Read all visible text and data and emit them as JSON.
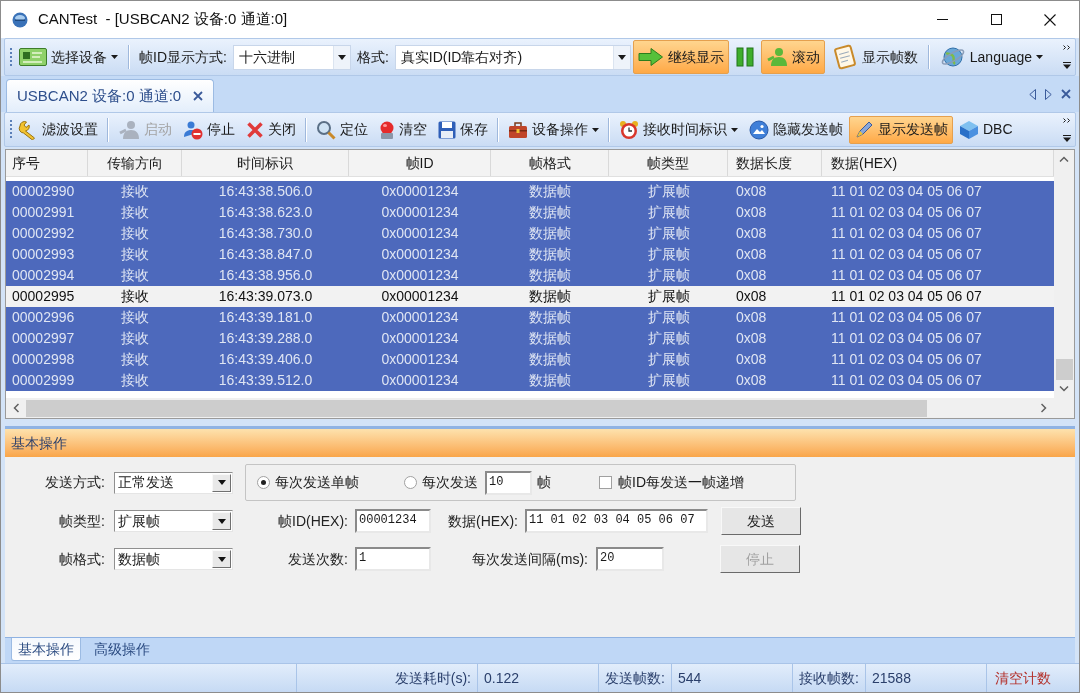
{
  "window": {
    "title": "CANTest  - [USBCAN2 设备:0 通道:0]"
  },
  "toolbar": {
    "items": [
      {
        "kind": "button",
        "label": "选择设备",
        "dropdown": true,
        "highlighted": false
      },
      {
        "kind": "separator"
      },
      {
        "kind": "label",
        "label": "帧ID显示方式:"
      },
      {
        "kind": "combo",
        "value": "十六进制"
      },
      {
        "kind": "label",
        "label": "格式:"
      },
      {
        "kind": "combo",
        "value": "真实ID(ID靠右对齐)"
      },
      {
        "kind": "button",
        "label": "继续显示",
        "dropdown": false,
        "highlighted": true
      },
      {
        "kind": "button",
        "dropdown": false,
        "highlighted": false
      },
      {
        "kind": "button",
        "label": "滚动",
        "dropdown": false,
        "highlighted": true
      },
      {
        "kind": "button",
        "label": "显示帧数",
        "dropdown": false,
        "highlighted": false
      },
      {
        "kind": "separator"
      },
      {
        "kind": "button",
        "label": "Language",
        "dropdown": true,
        "highlighted": false
      }
    ]
  },
  "document_tabs": [
    {
      "label": "USBCAN2 设备:0 通道:0",
      "selected": true
    }
  ],
  "toolbar_2": {
    "items": [
      {
        "kind": "button",
        "label": "滤波设置",
        "dropdown": false,
        "highlighted": false,
        "disabled": false
      },
      {
        "kind": "separator"
      },
      {
        "kind": "button",
        "label": "启动",
        "dropdown": false,
        "highlighted": false,
        "disabled": true
      },
      {
        "kind": "button",
        "label": "停止",
        "dropdown": false,
        "highlighted": false,
        "disabled": false
      },
      {
        "kind": "button",
        "label": "关闭",
        "dropdown": false,
        "highlighted": false,
        "disabled": false
      },
      {
        "kind": "separator"
      },
      {
        "kind": "button",
        "label": "定位",
        "dropdown": false,
        "highlighted": false,
        "disabled": false
      },
      {
        "kind": "button",
        "label": "清空",
        "dropdown": false,
        "highlighted": false,
        "disabled": false
      },
      {
        "kind": "button",
        "label": "保存",
        "dropdown": false,
        "highlighted": false,
        "disabled": false
      },
      {
        "kind": "separator"
      },
      {
        "kind": "button",
        "label": "设备操作",
        "dropdown": true,
        "highlighted": false,
        "disabled": false
      },
      {
        "kind": "separator"
      },
      {
        "kind": "button",
        "label": "接收时间标识",
        "dropdown": true,
        "highlighted": false,
        "disabled": false
      },
      {
        "kind": "button",
        "label": "隐藏发送帧",
        "dropdown": false,
        "highlighted": false,
        "disabled": false
      },
      {
        "kind": "button",
        "label": "显示发送帧",
        "dropdown": false,
        "highlighted": true,
        "disabled": false
      },
      {
        "kind": "button",
        "label": "DBC",
        "dropdown": false,
        "highlighted": false,
        "disabled": false
      }
    ]
  },
  "table": {
    "columns": [
      "序号",
      "传输方向",
      "时间标识",
      "帧ID",
      "帧格式",
      "帧类型",
      "数据长度",
      "数据(HEX)"
    ],
    "rows": [
      {
        "cells": [
          "00002990",
          "接收",
          "16:43:38.506.0",
          "0x00001234",
          "数据帧",
          "扩展帧",
          "0x08",
          "11 01 02 03 04 05 06 07"
        ],
        "selected": true
      },
      {
        "cells": [
          "00002991",
          "接收",
          "16:43:38.623.0",
          "0x00001234",
          "数据帧",
          "扩展帧",
          "0x08",
          "11 01 02 03 04 05 06 07"
        ],
        "selected": true
      },
      {
        "cells": [
          "00002992",
          "接收",
          "16:43:38.730.0",
          "0x00001234",
          "数据帧",
          "扩展帧",
          "0x08",
          "11 01 02 03 04 05 06 07"
        ],
        "selected": true
      },
      {
        "cells": [
          "00002993",
          "接收",
          "16:43:38.847.0",
          "0x00001234",
          "数据帧",
          "扩展帧",
          "0x08",
          "11 01 02 03 04 05 06 07"
        ],
        "selected": true
      },
      {
        "cells": [
          "00002994",
          "接收",
          "16:43:38.956.0",
          "0x00001234",
          "数据帧",
          "扩展帧",
          "0x08",
          "11 01 02 03 04 05 06 07"
        ],
        "selected": true
      },
      {
        "cells": [
          "00002995",
          "接收",
          "16:43:39.073.0",
          "0x00001234",
          "数据帧",
          "扩展帧",
          "0x08",
          "11 01 02 03 04 05 06 07"
        ],
        "selected": false
      },
      {
        "cells": [
          "00002996",
          "接收",
          "16:43:39.181.0",
          "0x00001234",
          "数据帧",
          "扩展帧",
          "0x08",
          "11 01 02 03 04 05 06 07"
        ],
        "selected": true
      },
      {
        "cells": [
          "00002997",
          "接收",
          "16:43:39.288.0",
          "0x00001234",
          "数据帧",
          "扩展帧",
          "0x08",
          "11 01 02 03 04 05 06 07"
        ],
        "selected": true
      },
      {
        "cells": [
          "00002998",
          "接收",
          "16:43:39.406.0",
          "0x00001234",
          "数据帧",
          "扩展帧",
          "0x08",
          "11 01 02 03 04 05 06 07"
        ],
        "selected": true
      },
      {
        "cells": [
          "00002999",
          "接收",
          "16:43:39.512.0",
          "0x00001234",
          "数据帧",
          "扩展帧",
          "0x08",
          "11 01 02 03 04 05 06 07"
        ],
        "selected": true
      }
    ]
  },
  "panel": {
    "title": "基本操作",
    "send_mode": {
      "label": "发送方式:",
      "value": "正常发送"
    },
    "frame_type": {
      "label": "帧类型:",
      "value": "扩展帧"
    },
    "frame_format": {
      "label": "帧格式:",
      "value": "数据帧"
    },
    "send_options": {
      "radios": [
        {
          "label": "每次发送单帧",
          "selected": true
        },
        {
          "label": "每次发送",
          "selected": false,
          "count": "10",
          "unit": "帧"
        }
      ],
      "increment_checkbox": {
        "label": "帧ID每发送一帧递增",
        "checked": false
      }
    },
    "frame_id": {
      "label": "帧ID(HEX):",
      "value": "00001234"
    },
    "data": {
      "label": "数据(HEX):",
      "value": "11 01 02 03 04 05 06 07"
    },
    "send_count": {
      "label": "发送次数:",
      "value": "1"
    },
    "interval": {
      "label": "每次发送间隔(ms):",
      "value": "20"
    },
    "buttons": [
      {
        "label": "发送",
        "disabled": false
      },
      {
        "label": "停止",
        "disabled": true
      }
    ]
  },
  "bottom_tabs": [
    {
      "label": "基本操作",
      "selected": true
    },
    {
      "label": "高级操作",
      "selected": false
    }
  ],
  "status_bar": {
    "items": [
      {
        "label": "发送耗时(s):",
        "value": "0.122"
      },
      {
        "label": "发送帧数:",
        "value": "544"
      },
      {
        "label": "接收帧数:",
        "value": "21588"
      }
    ],
    "clear_button": "清空计数"
  }
}
